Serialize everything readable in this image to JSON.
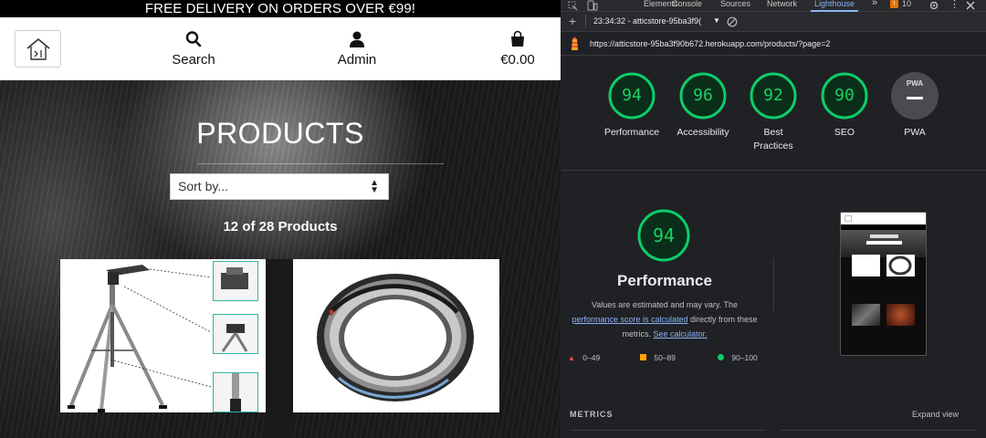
{
  "site": {
    "banner": "FREE DELIVERY ON ORDERS OVER €99!",
    "nav": {
      "search_label": "Search",
      "admin_label": "Admin",
      "cart_label": "€0.00"
    },
    "page_title": "PRODUCTS",
    "sort_placeholder": "Sort by...",
    "product_count": "12 of 28 Products"
  },
  "devtools": {
    "tabs": [
      "Elements",
      "Console",
      "Sources",
      "Network",
      "Lighthouse"
    ],
    "active_tab": "Lighthouse",
    "more_tabs": "»",
    "issues_count": "10",
    "report_time": "23:34:32 - atticstore-95ba3f9(",
    "url": "https://atticstore-95ba3f90b672.herokuapp.com/products/?page=2",
    "scores": [
      {
        "label": "Performance",
        "value": 94
      },
      {
        "label": "Accessibility",
        "value": 96
      },
      {
        "label": "Best Practices",
        "value": 92
      },
      {
        "label": "SEO",
        "value": 90
      },
      {
        "label": "PWA",
        "value": null
      }
    ],
    "pwa_badge": "PWA",
    "perf_score": "94",
    "perf_title": "Performance",
    "note_before": "Values are estimated and may vary. The",
    "note_link_1": "performance score is calculated",
    "note_middle": "directly from these metrics.",
    "note_link_2": "See calculator.",
    "legend": [
      "0–49",
      "50–89",
      "90–100"
    ],
    "metrics_label": "METRICS",
    "expand_label": "Expand view",
    "colors": {
      "good": "#0cce6b",
      "average": "#ffa400",
      "poor": "#ff4e42",
      "link": "#8ab4f8"
    }
  }
}
